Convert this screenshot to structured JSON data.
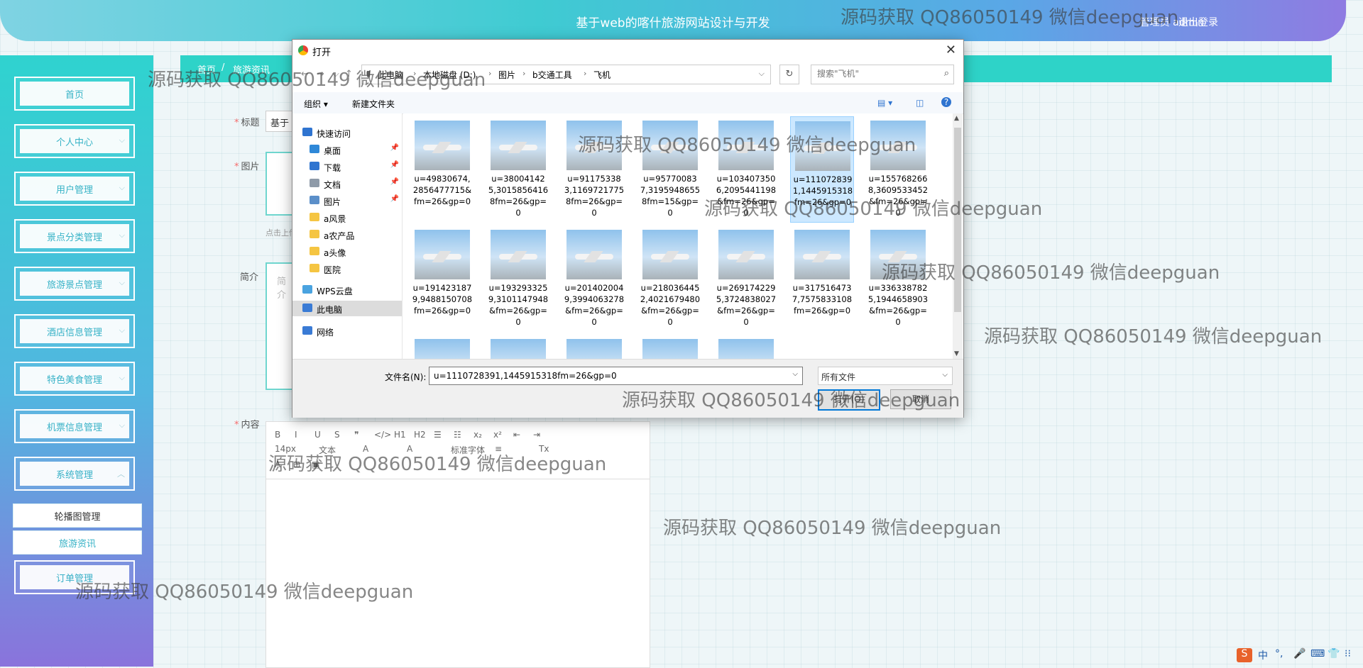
{
  "header": {
    "title": "基于web的喀什旅游网站设计与开发",
    "user": "管理员 admin",
    "logout": "退出登录"
  },
  "breadcrumb": {
    "home": "首页",
    "sep": "/",
    "current": "旅游资讯"
  },
  "sidebar": {
    "items": [
      {
        "label": "首页",
        "chevron": ""
      },
      {
        "label": "个人中心",
        "chevron": "⌵"
      },
      {
        "label": "用户管理",
        "chevron": "⌵"
      },
      {
        "label": "景点分类管理",
        "chevron": "⌵"
      },
      {
        "label": "旅游景点管理",
        "chevron": "⌵"
      },
      {
        "label": "酒店信息管理",
        "chevron": "⌵"
      },
      {
        "label": "特色美食管理",
        "chevron": "⌵"
      },
      {
        "label": "机票信息管理",
        "chevron": "⌵"
      },
      {
        "label": "系统管理",
        "chevron": "︿"
      },
      {
        "label": "订单管理",
        "chevron": ""
      }
    ],
    "submenu": [
      {
        "label": "轮播图管理"
      },
      {
        "label": "旅游资讯"
      }
    ]
  },
  "form": {
    "title_label": "标题",
    "title_value": "基于",
    "image_label": "图片",
    "upload_hint": "点击上传",
    "intro_label": "简介",
    "intro_placeholder": "简介",
    "content_label": "内容"
  },
  "editor": {
    "row1": [
      "B",
      "I",
      "U",
      "S",
      "❞",
      "</>",
      "H1",
      "H2",
      "☰",
      "☷",
      "x₂",
      "x²",
      "⇤",
      "⇥"
    ],
    "row2": [
      "14px",
      "文本",
      "A",
      "A",
      "标准字体",
      "≡",
      "Tx"
    ],
    "row3": [
      "A",
      "⊞",
      "▣"
    ]
  },
  "dialog": {
    "title": "打开",
    "close": "✕",
    "path": [
      "此电脑",
      "本地磁盘 (D:)",
      "图片",
      "b交通工具",
      "飞机"
    ],
    "search_placeholder": "搜索\"飞机\"",
    "toolbar": {
      "organize": "组织 ▾",
      "new_folder": "新建文件夹",
      "help": "?"
    },
    "nav": [
      {
        "label": "快速访问",
        "color": "#2f74d0",
        "pin": ""
      },
      {
        "label": "桌面",
        "color": "#2f88d8",
        "pin": "📌"
      },
      {
        "label": "下载",
        "color": "#2f74d0",
        "pin": "📌"
      },
      {
        "label": "文档",
        "color": "#8e9aa8",
        "pin": "📌"
      },
      {
        "label": "图片",
        "color": "#5b8fc9",
        "pin": "📌"
      },
      {
        "label": "a风景",
        "color": "#f5c542",
        "pin": ""
      },
      {
        "label": "a农产品",
        "color": "#f5c542",
        "pin": ""
      },
      {
        "label": "a头像",
        "color": "#f5c542",
        "pin": ""
      },
      {
        "label": "医院",
        "color": "#f5c542",
        "pin": ""
      },
      {
        "label": "WPS云盘",
        "color": "#4aa3e0",
        "pin": ""
      },
      {
        "label": "此电脑",
        "color": "#3a7bd5",
        "pin": ""
      },
      {
        "label": "网络",
        "color": "#3a7bd5",
        "pin": ""
      }
    ],
    "files": [
      {
        "name": "u=49830674,2856477715&fm=26&gp=0"
      },
      {
        "name": "u=380041425,30158564168fm=26&gp=0"
      },
      {
        "name": "u=911753383,11697217758fm=26&gp=0"
      },
      {
        "name": "u=957700837,31959486558fm=15&gp=0"
      },
      {
        "name": "u=1034073506,2095441198&fm=26&gp=0"
      },
      {
        "name": "u=1110728391,1445915318fm=26&gp=0"
      },
      {
        "name": "u=1557682668,3609533452&fm=26&gp=0"
      },
      {
        "name": "u=1914231879,9488150708fm=26&gp=0"
      },
      {
        "name": "u=1932933259,3101147948&fm=26&gp=0"
      },
      {
        "name": "u=2014020049,3994063278&fm=26&gp=0"
      },
      {
        "name": "u=2180364452,4021679480&fm=26&gp=0"
      },
      {
        "name": "u=2691742295,3724838027&fm=26&gp=0"
      },
      {
        "name": "u=3175164737,7575833108fm=26&gp=0"
      },
      {
        "name": "u=3363387825,1944658903&fm=26&gp=0"
      }
    ],
    "filename_label": "文件名(N):",
    "filename_value": "u=1110728391,1445915318fm=26&gp=0",
    "filetype": "所有文件",
    "open": "打开(O)",
    "cancel": "取消"
  },
  "watermark": "源码获取 QQ86050149 微信deepguan",
  "tray": [
    "S",
    "中",
    "°,",
    "🎤",
    "⌨",
    "👕",
    "⁝⁝"
  ]
}
